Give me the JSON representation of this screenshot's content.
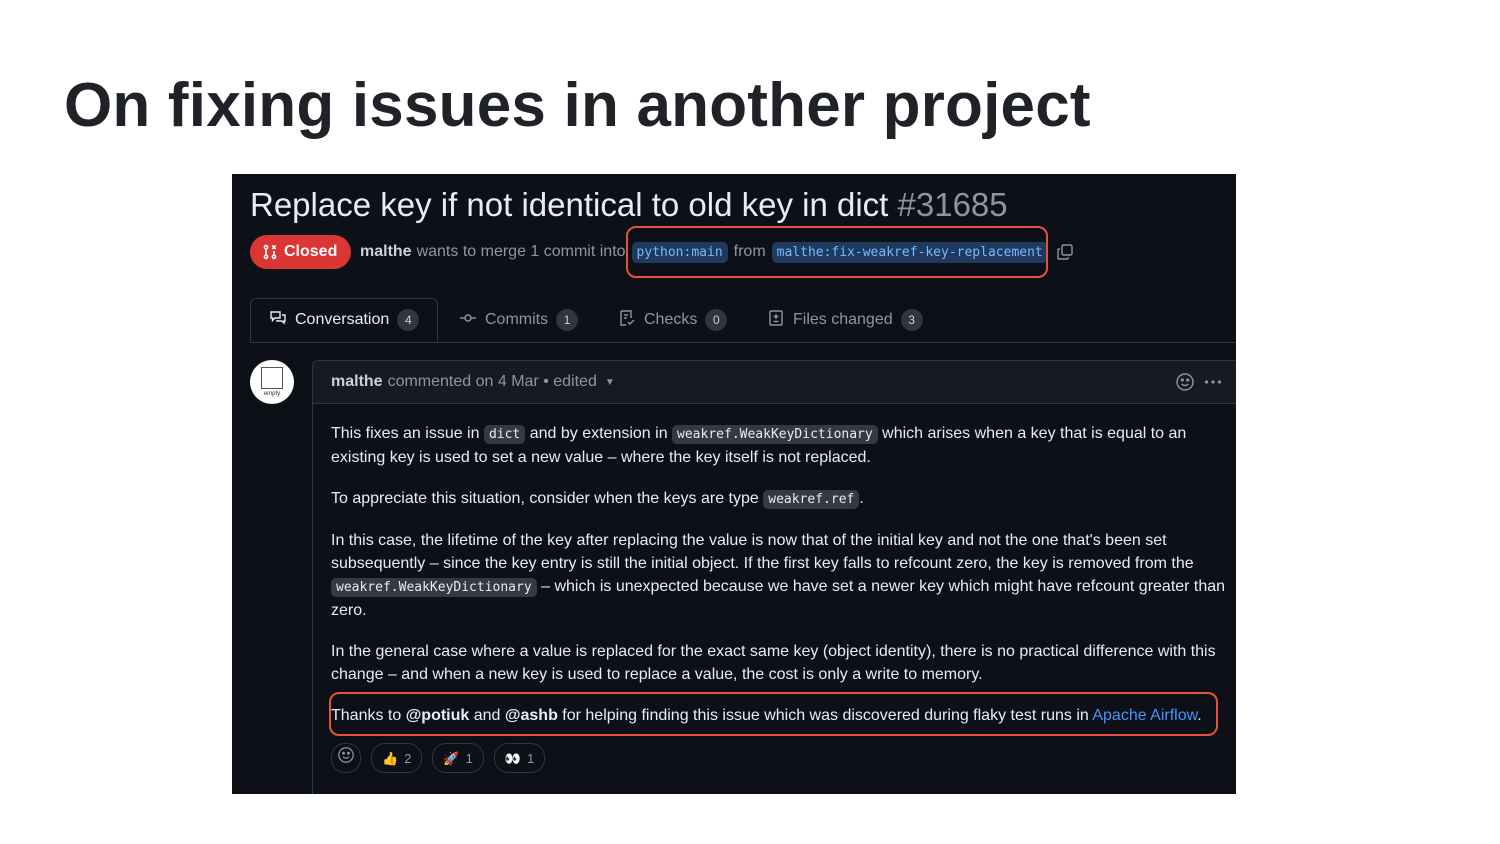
{
  "slide": {
    "title": "On fixing issues in another project"
  },
  "pr": {
    "title": "Replace key if not identical to old key in dict",
    "number": "#31685",
    "status": "Closed",
    "author": "malthe",
    "merge_text": "wants to merge 1 commit into",
    "base_branch": "python:main",
    "from_word": "from",
    "head_branch": "malthe:fix-weakref-key-replacement"
  },
  "tabs": [
    {
      "label": "Conversation",
      "count": "4"
    },
    {
      "label": "Commits",
      "count": "1"
    },
    {
      "label": "Checks",
      "count": "0"
    },
    {
      "label": "Files changed",
      "count": "3"
    }
  ],
  "avatar": {
    "label": "empty"
  },
  "comment": {
    "author": "malthe",
    "meta": "commented on 4 Mar • edited",
    "p1_a": "This fixes an issue in ",
    "p1_code1": "dict",
    "p1_b": " and by extension in ",
    "p1_code2": "weakref.WeakKeyDictionary",
    "p1_c": " which arises when a key that is equal to an existing key is used to set a new value – where the key itself is not replaced.",
    "p2_a": "To appreciate this situation, consider when the keys are type ",
    "p2_code": "weakref.ref",
    "p2_b": ".",
    "p3_a": "In this case, the lifetime of the key after replacing the value is now that of the initial key and not the one that's been set subsequently – since the key entry is still the initial object. If the first key falls to refcount zero, the key is removed from the ",
    "p3_code": "weakref.WeakKeyDictionary",
    "p3_b": " – which is unexpected because we have set a newer key which might have refcount greater than zero.",
    "p4": "In the general case where a value is replaced for the exact same key (object identity), there is no practical difference with this change – and when a new key is used to replace a value, the cost is only a write to memory.",
    "p5_a": "Thanks to ",
    "p5_mention1": "@potiuk",
    "p5_b": " and ",
    "p5_mention2": "@ashb",
    "p5_c": " for helping finding this issue which was discovered during flaky test runs in ",
    "p5_link": "Apache Airflow",
    "p5_d": "."
  },
  "reactions": [
    {
      "icon": "thumbs-up",
      "count": "2"
    },
    {
      "icon": "rocket",
      "count": "1"
    },
    {
      "icon": "eyes",
      "count": "1"
    }
  ],
  "colors": {
    "closed_badge": "#da3633",
    "highlight_box": "#e5533d",
    "link": "#4493f8",
    "background": "#0d1117"
  }
}
